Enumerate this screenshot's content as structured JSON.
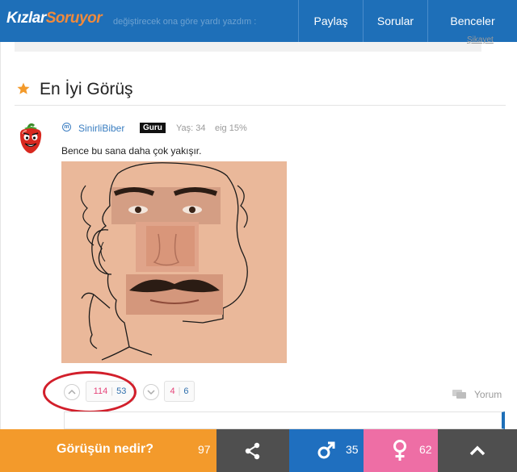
{
  "header": {
    "logo": {
      "part1": "Kızlar",
      "part2": "Soruyor"
    },
    "ghost_text": "değiştirecek ona göre yardı yazdım :",
    "nav": [
      {
        "label": "Paylaş"
      },
      {
        "label": "Sorular"
      },
      {
        "label": "Benceler"
      }
    ]
  },
  "previous": {
    "report_label": "Şikayet"
  },
  "section": {
    "title": "En İyi Görüş"
  },
  "post": {
    "username": "SinirliBiber",
    "badge": "Guru",
    "age": "Yaş: 34",
    "stat": "eig 15%",
    "text": "Bence bu sana daha çok yakışır."
  },
  "votes": {
    "first": {
      "pink": "114",
      "blue": "53"
    },
    "second": {
      "pink": "4",
      "blue": "6"
    },
    "comment_label": "Yorum"
  },
  "bottom_bar": {
    "cta_label": "Görüşün nedir?",
    "cta_count": "97",
    "male_count": "35",
    "female_count": "62"
  },
  "colors": {
    "brand_blue": "#1e6fb8",
    "orange": "#f39a2b",
    "pink": "#ee6ea5",
    "dark": "#4f4f4f",
    "highlight_red": "#d21f2b"
  }
}
